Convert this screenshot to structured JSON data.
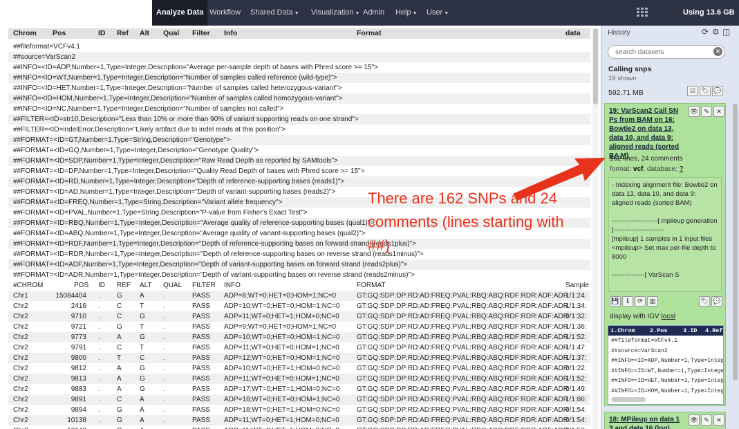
{
  "nav": {
    "items": [
      "Analyze Data",
      "Workflow",
      "Shared Data",
      "Visualization",
      "Admin",
      "Help",
      "User"
    ],
    "usage": "Using 13.6 GB"
  },
  "table": {
    "columns": [
      "Chrom",
      "Pos",
      "ID",
      "Ref",
      "Alt",
      "Qual",
      "Filter",
      "Info",
      "Format",
      "data"
    ],
    "meta_lines": [
      "##fileformat=VCFv4.1",
      "##source=VarScan2",
      "##INFO=<ID=ADP,Number=1,Type=Integer,Description=\"Average per-sample depth of bases with Phred score >= 15\">",
      "##INFO=<ID=WT,Number=1,Type=Integer,Description=\"Number of samples called reference (wild-type)\">",
      "##INFO=<ID=HET,Number=1,Type=Integer,Description=\"Number of samples called heterozygous-variant\">",
      "##INFO=<ID=HOM,Number=1,Type=Integer,Description=\"Number of samples called homozygous-variant\">",
      "##INFO=<ID=NC,Number=1,Type=Integer,Description=\"Number of samples not called\">",
      "##FILTER=<ID=str10,Description=\"Less than 10% or more than 90% of variant supporting reads on one strand\">",
      "##FILTER=<ID=indelError,Description=\"Likely artifact due to indel reads at this position\">",
      "##FORMAT=<ID=GT,Number=1,Type=String,Description=\"Genotype\">",
      "##FORMAT=<ID=GQ,Number=1,Type=Integer,Description=\"Genotype Quality\">",
      "##FORMAT=<ID=SDP,Number=1,Type=Integer,Description=\"Raw Read Depth as reported by SAMtools\">",
      "##FORMAT=<ID=DP,Number=1,Type=Integer,Description=\"Quality Read Depth of bases with Phred score >= 15\">",
      "##FORMAT=<ID=RD,Number=1,Type=Integer,Description=\"Depth of reference-supporting bases (reads1)\">",
      "##FORMAT=<ID=AD,Number=1,Type=Integer,Description=\"Depth of variant-supporting bases (reads2)\">",
      "##FORMAT=<ID=FREQ,Number=1,Type=String,Description=\"Variant allele frequency\">",
      "##FORMAT=<ID=PVAL,Number=1,Type=String,Description=\"P-value from Fisher's Exact Test\">",
      "##FORMAT=<ID=RBQ,Number=1,Type=Integer,Description=\"Average quality of reference-supporting bases (qual1)\">",
      "##FORMAT=<ID=ABQ,Number=1,Type=Integer,Description=\"Average quality of variant-supporting bases (qual2)\">",
      "##FORMAT=<ID=RDF,Number=1,Type=Integer,Description=\"Depth of reference-supporting bases on forward strand (reads1plus)\">",
      "##FORMAT=<ID=RDR,Number=1,Type=Integer,Description=\"Depth of reference-supporting bases on reverse strand (reads1minus)\">",
      "##FORMAT=<ID=ADF,Number=1,Type=Integer,Description=\"Depth of variant-supporting bases on forward strand (reads2plus)\">",
      "##FORMAT=<ID=ADR,Number=1,Type=Integer,Description=\"Depth of variant-supporting bases on reverse strand (reads2minus)\">"
    ],
    "chrom_header": [
      "#CHROM",
      "POS",
      "ID",
      "REF",
      "ALT",
      "QUAL",
      "FILTER",
      "INFO",
      "FORMAT",
      "Sample"
    ],
    "rows": [
      [
        "Chr1",
        "15084404",
        ".",
        "G",
        "A",
        ".",
        "PASS",
        "ADP=8;WT=0;HET=0;HOM=1;NC=0",
        "GT:GQ:SDP:DP:RD:AD:FREQ:PVAL:RBQ:ABQ:RDF:RDR:ADF:ADR",
        "1/1:24:"
      ],
      [
        "Chr2",
        "2416",
        ".",
        "C",
        "T",
        ".",
        "PASS",
        "ADP=10;WT=0;HET=0;HOM=1;NC=0",
        "GT:GQ:SDP:DP:RD:AD:FREQ:PVAL:RBQ:ABQ:RDF:RDR:ADF:ADR",
        "1/1:34:"
      ],
      [
        "Chr2",
        "9710",
        ".",
        "C",
        "G",
        ".",
        "PASS",
        "ADP=11;WT=0;HET=1;HOM=0;NC=0",
        "GT:GQ:SDP:DP:RD:AD:FREQ:PVAL:RBQ:ABQ:RDF:RDR:ADF:ADR",
        "0/1:32:"
      ],
      [
        "Chr2",
        "9721",
        ".",
        "G",
        "T",
        ".",
        "PASS",
        "ADP=9;WT=0;HET=0;HOM=1;NC=0",
        "GT:GQ:SDP:DP:RD:AD:FREQ:PVAL:RBQ:ABQ:RDF:RDR:ADF:ADR",
        "1/1:36:"
      ],
      [
        "Chr2",
        "9773",
        ".",
        "A",
        "G",
        ".",
        "PASS",
        "ADP=10;WT=0;HET=0;HOM=1;NC=0",
        "GT:GQ:SDP:DP:RD:AD:FREQ:PVAL:RBQ:ABQ:RDF:RDR:ADF:ADR",
        "1/1:52:"
      ],
      [
        "Chr2",
        "9791",
        ".",
        "C",
        "T",
        ".",
        "PASS",
        "ADP=11;WT=0;HET=0;HOM=1;NC=0",
        "GT:GQ:SDP:DP:RD:AD:FREQ:PVAL:RBQ:ABQ:RDF:RDR:ADF:ADR",
        "1/1:47:"
      ],
      [
        "Chr2",
        "9800",
        ".",
        "T",
        "C",
        ".",
        "PASS",
        "ADP=12;WT=0;HET=0;HOM=1;NC=0",
        "GT:GQ:SDP:DP:RD:AD:FREQ:PVAL:RBQ:ABQ:RDF:RDR:ADF:ADR",
        "1/1:37:"
      ],
      [
        "Chr2",
        "9812",
        ".",
        "A",
        "G",
        ".",
        "PASS",
        "ADP=10;WT=0;HET=1;HOM=0;NC=0",
        "GT:GQ:SDP:DP:RD:AD:FREQ:PVAL:RBQ:ABQ:RDF:RDR:ADF:ADR",
        "0/1:22:"
      ],
      [
        "Chr2",
        "9813",
        ".",
        "A",
        "G",
        ".",
        "PASS",
        "ADP=11;WT=0;HET=0;HOM=1;NC=0",
        "GT:GQ:SDP:DP:RD:AD:FREQ:PVAL:RBQ:ABQ:RDF:RDR:ADF:ADR",
        "1/1:52:"
      ],
      [
        "Chr2",
        "9883",
        ".",
        "A",
        "G",
        ".",
        "PASS",
        "ADP=17;WT=0;HET=1;HOM=0;NC=0",
        "GT:GQ:SDP:DP:RD:AD:FREQ:PVAL:RBQ:ABQ:RDF:RDR:ADF:ADR",
        "0/1:49:"
      ],
      [
        "Chr2",
        "9891",
        ".",
        "C",
        "A",
        ".",
        "PASS",
        "ADP=18;WT=0;HET=0;HOM=1;NC=0",
        "GT:GQ:SDP:DP:RD:AD:FREQ:PVAL:RBQ:ABQ:RDF:RDR:ADF:ADR",
        "1/1:86:"
      ],
      [
        "Chr2",
        "9894",
        ".",
        "G",
        "A",
        ".",
        "PASS",
        "ADP=18;WT=0;HET=1;HOM=0;NC=0",
        "GT:GQ:SDP:DP:RD:AD:FREQ:PVAL:RBQ:ABQ:RDF:RDR:ADF:ADR",
        "0/1:54:"
      ],
      [
        "Chr2",
        "10138",
        ".",
        "G",
        "A",
        ".",
        "PASS",
        "ADP=11;WT=0;HET=1;HOM=0;NC=0",
        "GT:GQ:SDP:DP:RD:AD:FREQ:PVAL:RBQ:ABQ:RDF:RDR:ADF:ADR",
        "0/1:54:"
      ],
      [
        "Chr2",
        "10142",
        ".",
        "C",
        "A",
        ".",
        "PASS",
        "ADP=11;WT=0;HET=1;HOM=0;NC=0",
        "GT:GQ:SDP:DP:RD:AD:FREQ:PVAL:RBQ:ABQ:RDF:RDR:ADF:ADR",
        "0/1:50:"
      ]
    ]
  },
  "history": {
    "title": "History",
    "search_placeholder": "search datasets",
    "name": "Calling snps",
    "shown": "19 shown",
    "size": "592.71 MB",
    "dataset19": {
      "title": "19: VarScan2 Call SN Ps from BAM on 16: Bowtie2 on data 13, data 10, and data 9: aligned reads (sorted BA M)",
      "lines": "162 lines, 24 comments",
      "format_label": "format:",
      "format_value": "vcf",
      "database_label": ", database:",
      "database_value": "?",
      "info": "- Indexing alignment file: Bowtie2 on data 13, data 10, and data 9: aligned reads (sorted BAM)\n\n---------------------[ mpileup generation ]-----------------------\n[mpileup] 1 samples in 1 input files\n<mpileup> Set max per-file depth to 8000\n\n---------------[ VarScan S",
      "display_label": "display with IGV",
      "display_link": "local",
      "peek_header": [
        "1.Chrom",
        "2.Pos",
        "3.ID",
        "4.Ref"
      ],
      "peek_lines": [
        "##fileformat=VCFv4.1",
        "##source=VarScan2",
        "##INFO=<ID=ADP,Number=1,Type=Integ",
        "##INFO=<ID=WT,Number=1,Type=Intege",
        "##INFO=<ID=HET,Number=1,Type=Integ",
        "##INFO=<ID=HOM,Number=1,Type=Integ"
      ]
    },
    "dataset18": {
      "title": "18: MPileup on data 1 3 and data 16 (log)"
    }
  },
  "annotation": {
    "text": "There are 162 SNPs and 24 comments (lines starting with ##)",
    "color": "#e8331c"
  }
}
